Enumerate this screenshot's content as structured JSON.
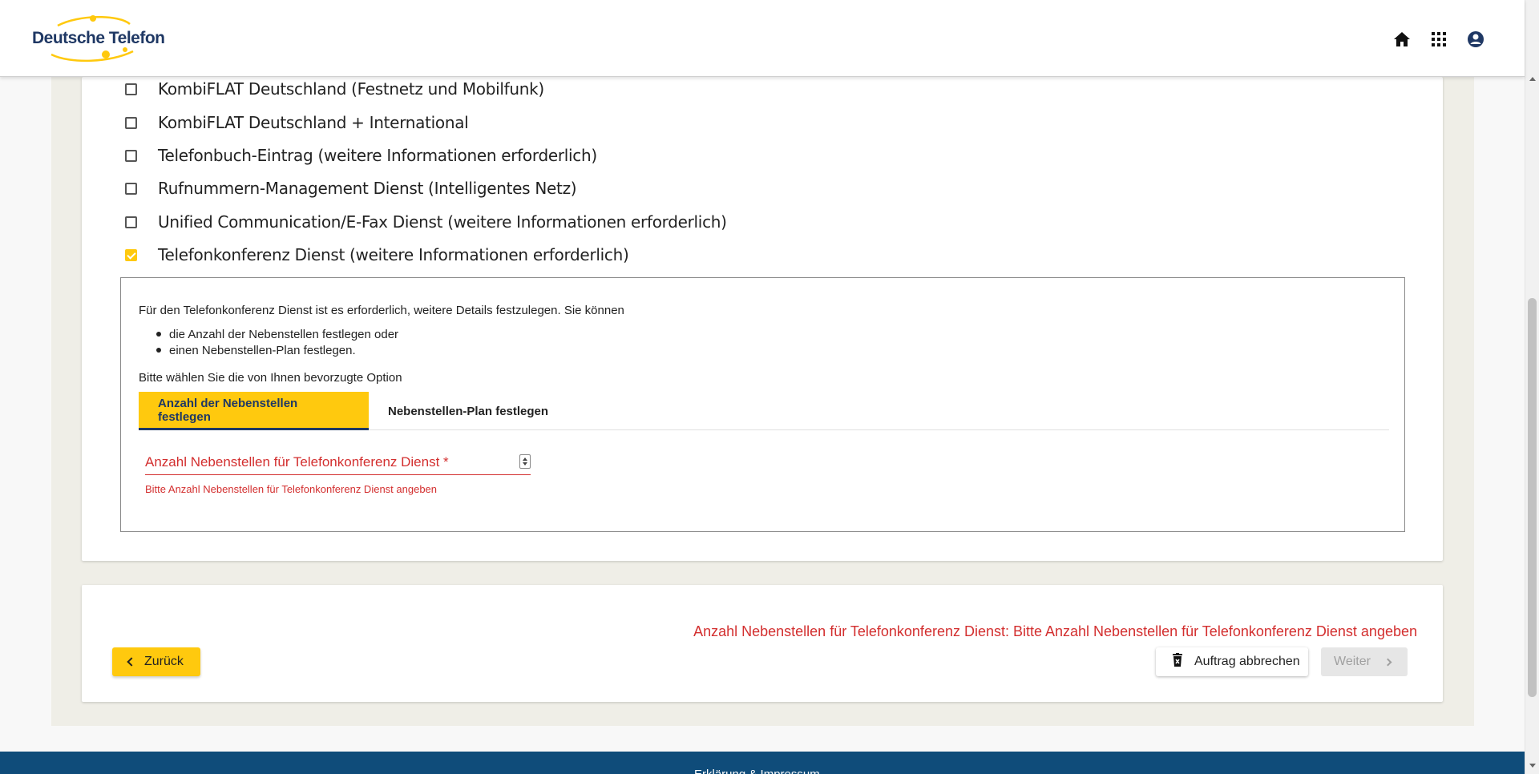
{
  "header": {
    "logo_text": "Deutsche Telefon",
    "icons": [
      "home-icon",
      "apps-grid-icon",
      "account-circle-icon"
    ]
  },
  "colors": {
    "accent": "#ffc90e",
    "brand_blue": "#1f3864",
    "error_red": "#d32f2f",
    "footer_blue": "#0f4c7a",
    "page_beige": "#efeee7"
  },
  "options": [
    {
      "label": "KombiFLAT Deutschland (Festnetz und Mobilfunk)",
      "checked": false
    },
    {
      "label": "KombiFLAT Deutschland + International",
      "checked": false
    },
    {
      "label": "Telefonbuch-Eintrag (weitere Informationen erforderlich)",
      "checked": false
    },
    {
      "label": "Rufnummern-Management Dienst (Intelligentes Netz)",
      "checked": false
    },
    {
      "label": "Unified Communication/E-Fax Dienst (weitere Informationen erforderlich)",
      "checked": false
    },
    {
      "label": "Telefonkonferenz Dienst (weitere Informationen erforderlich)",
      "checked": true
    }
  ],
  "detail": {
    "intro": "Für den Telefonkonferenz Dienst ist es erforderlich, weitere Details festzulegen. Sie können",
    "list": [
      "die Anzahl der Nebenstellen festlegen oder",
      "einen Nebenstellen-Plan festlegen."
    ],
    "choose": "Bitte wählen Sie die von Ihnen bevorzugte Option",
    "tabs": [
      {
        "label": "Anzahl der Nebenstellen festlegen",
        "active": true
      },
      {
        "label": "Nebenstellen-Plan festlegen",
        "active": false
      }
    ],
    "field": {
      "label": "Anzahl Nebenstellen für Telefonkonferenz Dienst *",
      "value": "",
      "error": "Bitte Anzahl Nebenstellen für Telefonkonferenz Dienst angeben"
    }
  },
  "bottom": {
    "error_summary": "Anzahl Nebenstellen für Telefonkonferenz Dienst: Bitte Anzahl Nebenstellen für Telefonkonferenz Dienst angeben",
    "back_label": "Zurück",
    "cancel_label": "Auftrag abbrechen",
    "next_label": "Weiter"
  },
  "footer": {
    "text": "Erklärung & Impressum"
  }
}
